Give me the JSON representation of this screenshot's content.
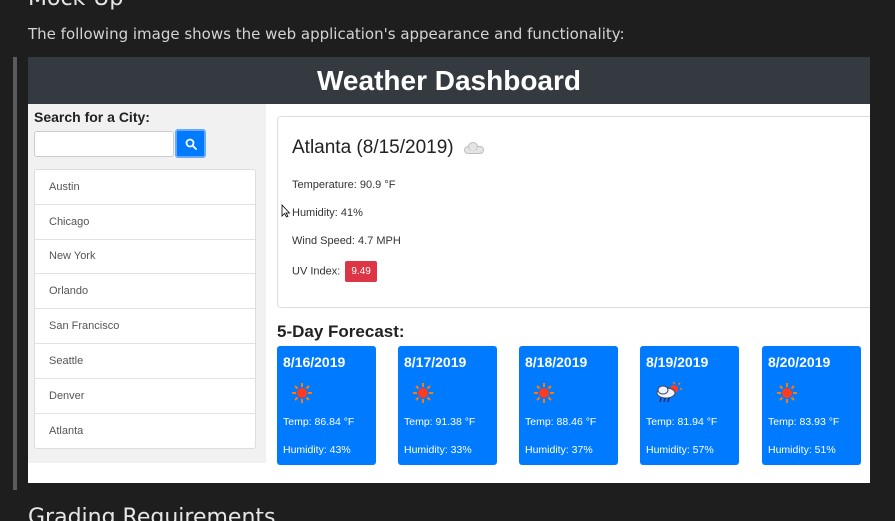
{
  "doc": {
    "heading_top": "Mock-Up",
    "intro": "The following image shows the web application's appearance and functionality:",
    "heading_bottom": "Grading Requirements"
  },
  "app": {
    "title": "Weather Dashboard",
    "search": {
      "label": "Search for a City:",
      "value": "",
      "button_icon": "search-icon"
    },
    "cities": [
      "Austin",
      "Chicago",
      "New York",
      "Orlando",
      "San Francisco",
      "Seattle",
      "Denver",
      "Atlanta"
    ],
    "current": {
      "title": "Atlanta (8/15/2019)",
      "icon": "cloud-icon",
      "temperature": "Temperature: 90.9 °F",
      "humidity": "Humidity: 41%",
      "wind": "Wind Speed: 4.7 MPH",
      "uv_label": "UV Index:",
      "uv_value": "9.49",
      "uv_color": "#dc3545"
    },
    "forecast_title": "5-Day Forecast:",
    "forecast": [
      {
        "date": "8/16/2019",
        "icon": "sun-icon",
        "temp": "Temp: 86.84 °F",
        "humidity": "Humidity: 43%"
      },
      {
        "date": "8/17/2019",
        "icon": "sun-icon",
        "temp": "Temp: 91.38 °F",
        "humidity": "Humidity: 33%"
      },
      {
        "date": "8/18/2019",
        "icon": "sun-icon",
        "temp": "Temp: 88.46 °F",
        "humidity": "Humidity: 37%"
      },
      {
        "date": "8/19/2019",
        "icon": "rain-cloud-sun-icon",
        "temp": "Temp: 81.94 °F",
        "humidity": "Humidity: 57%"
      },
      {
        "date": "8/20/2019",
        "icon": "sun-icon",
        "temp": "Temp: 83.93 °F",
        "humidity": "Humidity: 51%"
      }
    ],
    "colors": {
      "header": "#343a40",
      "accent": "#007bff",
      "sidebar": "#f1f1f1"
    }
  }
}
